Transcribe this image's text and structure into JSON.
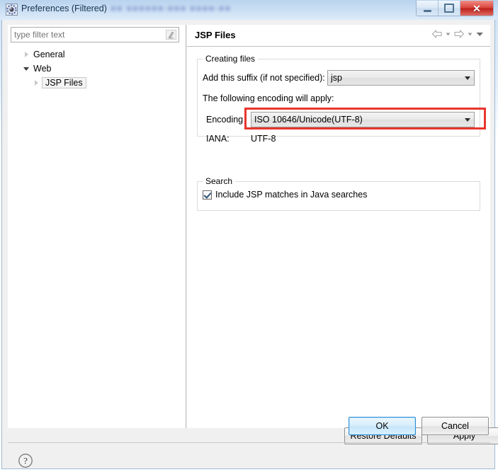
{
  "window": {
    "title": "Preferences (Filtered)",
    "icon": "preferences-gear-icon",
    "backdrop_text": "blurred background text",
    "controls": {
      "minimize": "Minimize",
      "maximize": "Maximize",
      "close": "Close",
      "close_glyph": "✕"
    }
  },
  "filter": {
    "placeholder": "type filter text",
    "value": "",
    "clear_icon": "clear-filter-icon"
  },
  "tree": {
    "items": [
      {
        "label": "General",
        "level": 1,
        "state": "collapsed",
        "selected": false
      },
      {
        "label": "Web",
        "level": 1,
        "state": "expanded",
        "selected": false
      },
      {
        "label": "JSP Files",
        "level": 2,
        "state": "collapsed",
        "selected": true
      }
    ]
  },
  "page": {
    "title": "JSP Files",
    "nav": {
      "back": "back-arrow-icon",
      "back_menu": "back-history-dropdown-icon",
      "forward": "forward-arrow-icon",
      "forward_menu": "forward-history-dropdown-icon",
      "menu": "view-menu-dropdown-icon"
    },
    "groups": [
      {
        "label": "Creating files",
        "suffix_label": "Add this suffix (if not specified):",
        "suffix_value": "jsp",
        "encoding_intro": "The following encoding will apply:",
        "encoding_label": "Encoding",
        "encoding_value": "ISO 10646/Unicode(UTF-8)",
        "iana_label": "IANA:",
        "iana_value": "UTF-8"
      },
      {
        "label": "Search",
        "checkbox_label": "Include JSP matches in Java searches",
        "checkbox_checked": true
      }
    ],
    "buttons": {
      "restore_defaults": "Restore Defaults",
      "apply": "Apply"
    }
  },
  "footer": {
    "help_icon": "help-question-icon",
    "ok": "OK",
    "cancel": "Cancel"
  },
  "annotation": {
    "color": "#e8352d",
    "target": "encoding-combo"
  }
}
